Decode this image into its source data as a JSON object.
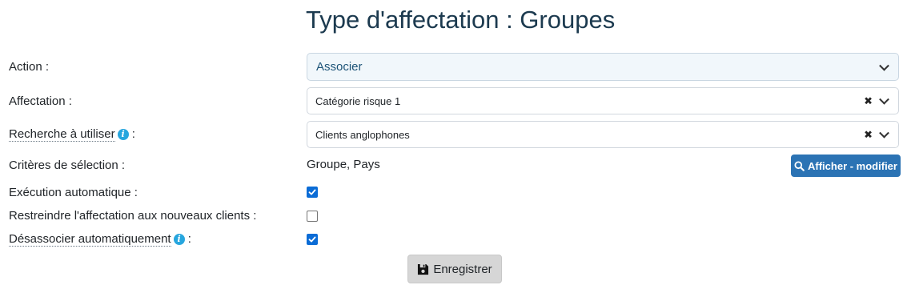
{
  "page": {
    "title": "Type d'affectation : Groupes"
  },
  "form": {
    "action": {
      "label": "Action :",
      "value": "Associer"
    },
    "affectation": {
      "label": "Affectation :",
      "value": "Catégorie risque 1",
      "clear": "✖"
    },
    "recherche": {
      "label": "Recherche à utiliser",
      "suffix": " :",
      "info": "i",
      "value": "Clients anglophones",
      "clear": "✖"
    },
    "criteres": {
      "label": "Critères de sélection :",
      "value": "Groupe, Pays",
      "button_label": "Afficher - modifier"
    },
    "execution": {
      "label": "Exécution automatique :",
      "checked": true
    },
    "restreindre": {
      "label": "Restreindre l'affectation aux nouveaux clients :",
      "checked": false
    },
    "desassocier": {
      "label": "Désassocier automatiquement",
      "suffix": " :",
      "info": "i",
      "checked": true
    }
  },
  "footer": {
    "save_label": "Enregistrer"
  },
  "colors": {
    "primary_button": "#2b73b4",
    "checkbox_checked": "#0b6cd6",
    "info_icon": "#27a6de"
  }
}
